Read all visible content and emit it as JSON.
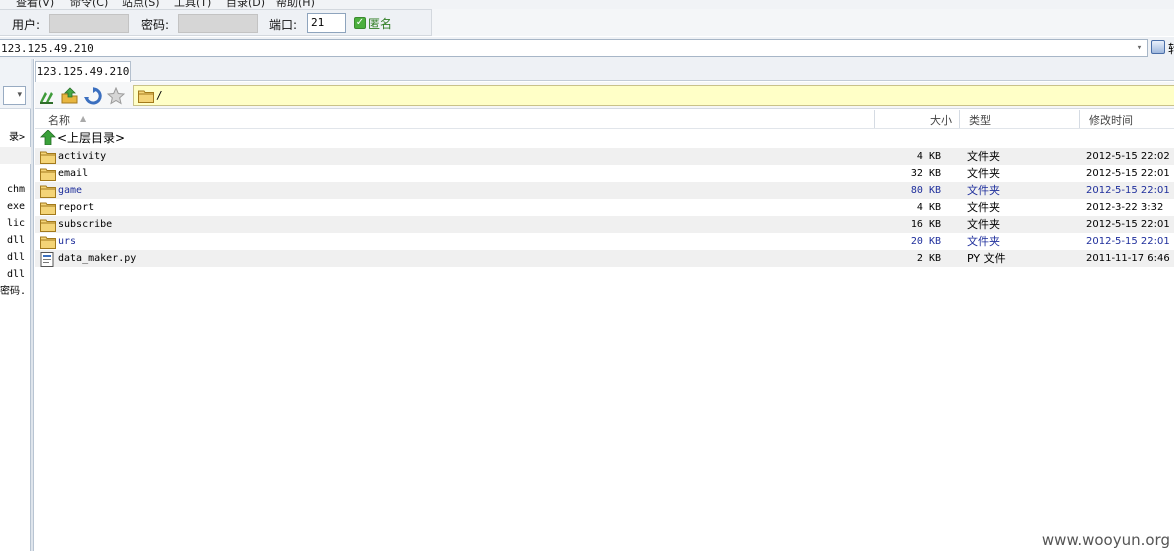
{
  "menu": {
    "items": [
      "查看(V)",
      "命令(C)",
      "站点(S)",
      "工具(T)",
      "目录(D)",
      "帮助(H)"
    ]
  },
  "connection": {
    "user_label": "用户:",
    "user_value": "",
    "password_label": "密码:",
    "password_value": "",
    "port_label": "端口:",
    "port_value": "21",
    "anonymous_label": "匿名",
    "anonymous_checked": true
  },
  "address": {
    "value": "123.125.49.210",
    "go_label": "转"
  },
  "local_pane": {
    "rows": [
      "录>",
      "",
      "",
      "chm",
      "exe",
      "lic",
      "dll",
      "dll",
      "dll",
      "密码."
    ]
  },
  "remote": {
    "tab_label": "123.125.49.210",
    "path": "/",
    "columns": {
      "name": "名称",
      "size": "大小",
      "type": "类型",
      "modified": "修改时间"
    },
    "parent_label": "<上层目录>",
    "files": [
      {
        "name": "activity",
        "size": "4 KB",
        "type": "文件夹",
        "modified": "2012-5-15 22:02",
        "kind": "folder",
        "highlight": false
      },
      {
        "name": "email",
        "size": "32 KB",
        "type": "文件夹",
        "modified": "2012-5-15 22:01",
        "kind": "folder",
        "highlight": false
      },
      {
        "name": "game",
        "size": "80 KB",
        "type": "文件夹",
        "modified": "2012-5-15 22:01",
        "kind": "folder",
        "highlight": true
      },
      {
        "name": "report",
        "size": "4 KB",
        "type": "文件夹",
        "modified": "2012-3-22 3:32",
        "kind": "folder",
        "highlight": false
      },
      {
        "name": "subscribe",
        "size": "16 KB",
        "type": "文件夹",
        "modified": "2012-5-15 22:01",
        "kind": "folder",
        "highlight": false
      },
      {
        "name": "urs",
        "size": "20 KB",
        "type": "文件夹",
        "modified": "2012-5-15 22:01",
        "kind": "folder",
        "highlight": true
      },
      {
        "name": "data_maker.py",
        "size": "2 KB",
        "type": "PY 文件",
        "modified": "2011-11-17 6:46",
        "kind": "file",
        "highlight": false
      }
    ]
  },
  "watermark": "www.wooyun.org",
  "icons": {
    "toolbar": [
      "path-edit-icon",
      "upload-folder-icon",
      "refresh-icon",
      "favorite-star-icon"
    ],
    "folder": "folder-icon",
    "file": "py-file-icon",
    "parent": "up-arrow-icon"
  }
}
